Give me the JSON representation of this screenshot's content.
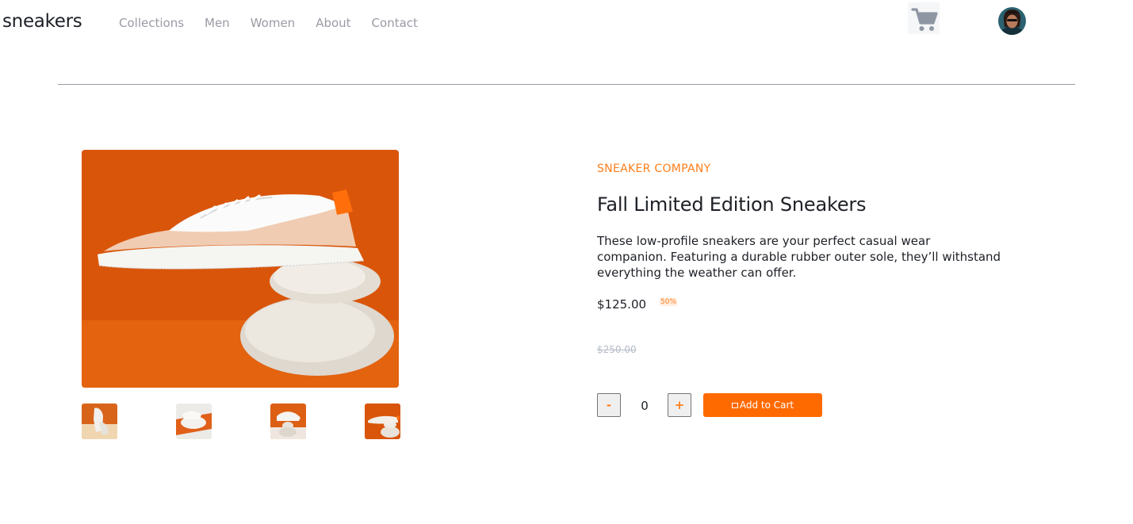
{
  "header": {
    "logo": "sneakers",
    "nav": [
      "Collections",
      "Men",
      "Women",
      "About",
      "Contact"
    ],
    "cart_icon": "cart-icon",
    "avatar_icon": "user-avatar"
  },
  "gallery": {
    "thumbnails": [
      "thumbnail-1",
      "thumbnail-2",
      "thumbnail-3",
      "thumbnail-4"
    ]
  },
  "product": {
    "company": "SNEAKER COMPANY",
    "title": "Fall Limited Edition Sneakers",
    "description": "These low-profile sneakers are your perfect casual wear companion. Featuring a durable rubber outer sole, they’ll withstand everything the weather can offer.",
    "price": "$125.00",
    "discount": "50%",
    "original_price": "$250.00"
  },
  "purchase": {
    "minus_label": "-",
    "plus_label": "+",
    "quantity": "0",
    "add_to_cart_label": "Add to Cart"
  },
  "colors": {
    "accent": "#ff7e1b",
    "button": "#ff6a00",
    "text": "#1d2026",
    "muted": "#9a9ba4"
  }
}
